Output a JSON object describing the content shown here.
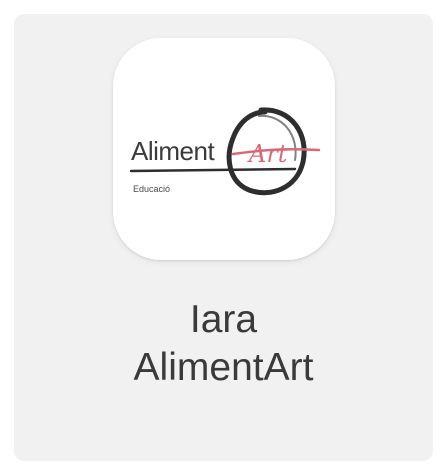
{
  "app": {
    "name_line1": "Iara",
    "name_line2": "AlimentArt",
    "icon": "alimentart-logo-icon",
    "logo": {
      "wordmark": "Aliment",
      "script": "Art",
      "subtitle": "Educació"
    }
  },
  "colors": {
    "tile_background": "#f1f1f1",
    "icon_background": "#ffffff",
    "text": "#3a3a3a",
    "logo_pink": "#d76a7a",
    "logo_dark": "#2e2e2e"
  }
}
